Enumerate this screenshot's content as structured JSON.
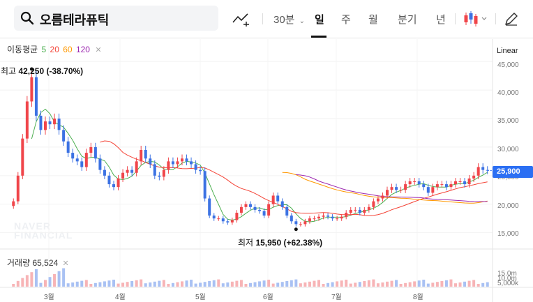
{
  "search": {
    "query": "오름테라퓨틱"
  },
  "toolbar": {
    "interval": "30분",
    "periods": [
      "일",
      "주",
      "월",
      "분기",
      "년"
    ],
    "active_period": "일"
  },
  "ma": {
    "title": "이동평균",
    "periods": [
      "5",
      "20",
      "60",
      "120"
    ],
    "colors": [
      "#4caf50",
      "#f44336",
      "#ff9800",
      "#9c27b0"
    ]
  },
  "scale_label": "Linear",
  "price_axis": [
    "45,000",
    "40,000",
    "35,000",
    "30,000",
    "25,000",
    "20,000",
    "15,000"
  ],
  "current_price": "25,900",
  "high_annotation": {
    "label": "최고",
    "value": "42,250 (-38.70%)"
  },
  "low_annotation": {
    "label": "최저",
    "value": "15,950 (+62.38%)"
  },
  "volume": {
    "title": "거래량",
    "value": "65,524",
    "axis": [
      "15.0m",
      "10.0m",
      "5,000k"
    ]
  },
  "x_axis": [
    "3월",
    "4월",
    "5월",
    "6월",
    "7월",
    "8월"
  ],
  "watermark": [
    "NAVER",
    "FINANCIAL"
  ],
  "colors": {
    "up": "#f0454a",
    "down": "#3c72e3",
    "accent": "#2b6ff3"
  },
  "chart_data": {
    "type": "candlestick",
    "ylim": [
      13000,
      46000
    ],
    "series": [
      {
        "name": "price",
        "values": [
          20500,
          25000,
          31500,
          38000,
          42250,
          35500,
          33000,
          34500,
          34000,
          35000,
          33000,
          31000,
          29000,
          28000,
          27500,
          26500,
          29000,
          30000,
          28000,
          26000,
          25000,
          23500,
          23000,
          24500,
          25500,
          26000,
          25500,
          27500,
          29500,
          28000,
          27000,
          25000,
          24800,
          26000,
          27500,
          27000,
          27500,
          28000,
          27500,
          27000,
          26000,
          25800,
          21000,
          18000,
          17500,
          17500,
          17000,
          16800,
          17200,
          18500,
          19500,
          20000,
          19500,
          19000,
          18800,
          18000,
          20000,
          21500,
          20500,
          19500,
          18000,
          17000,
          16500,
          16500,
          17000,
          17500,
          17500,
          17800,
          18000,
          17800,
          17500,
          17500,
          17800,
          18500,
          19000,
          19000,
          18500,
          19000,
          19500,
          20500,
          21000,
          21500,
          22500,
          23000,
          22500,
          22500,
          23500,
          24000,
          24000,
          23500,
          23000,
          22000,
          23000,
          23500,
          23500,
          23000,
          23500,
          24000,
          24000,
          23500,
          24500,
          25000,
          26500,
          26000,
          25900
        ]
      }
    ]
  }
}
